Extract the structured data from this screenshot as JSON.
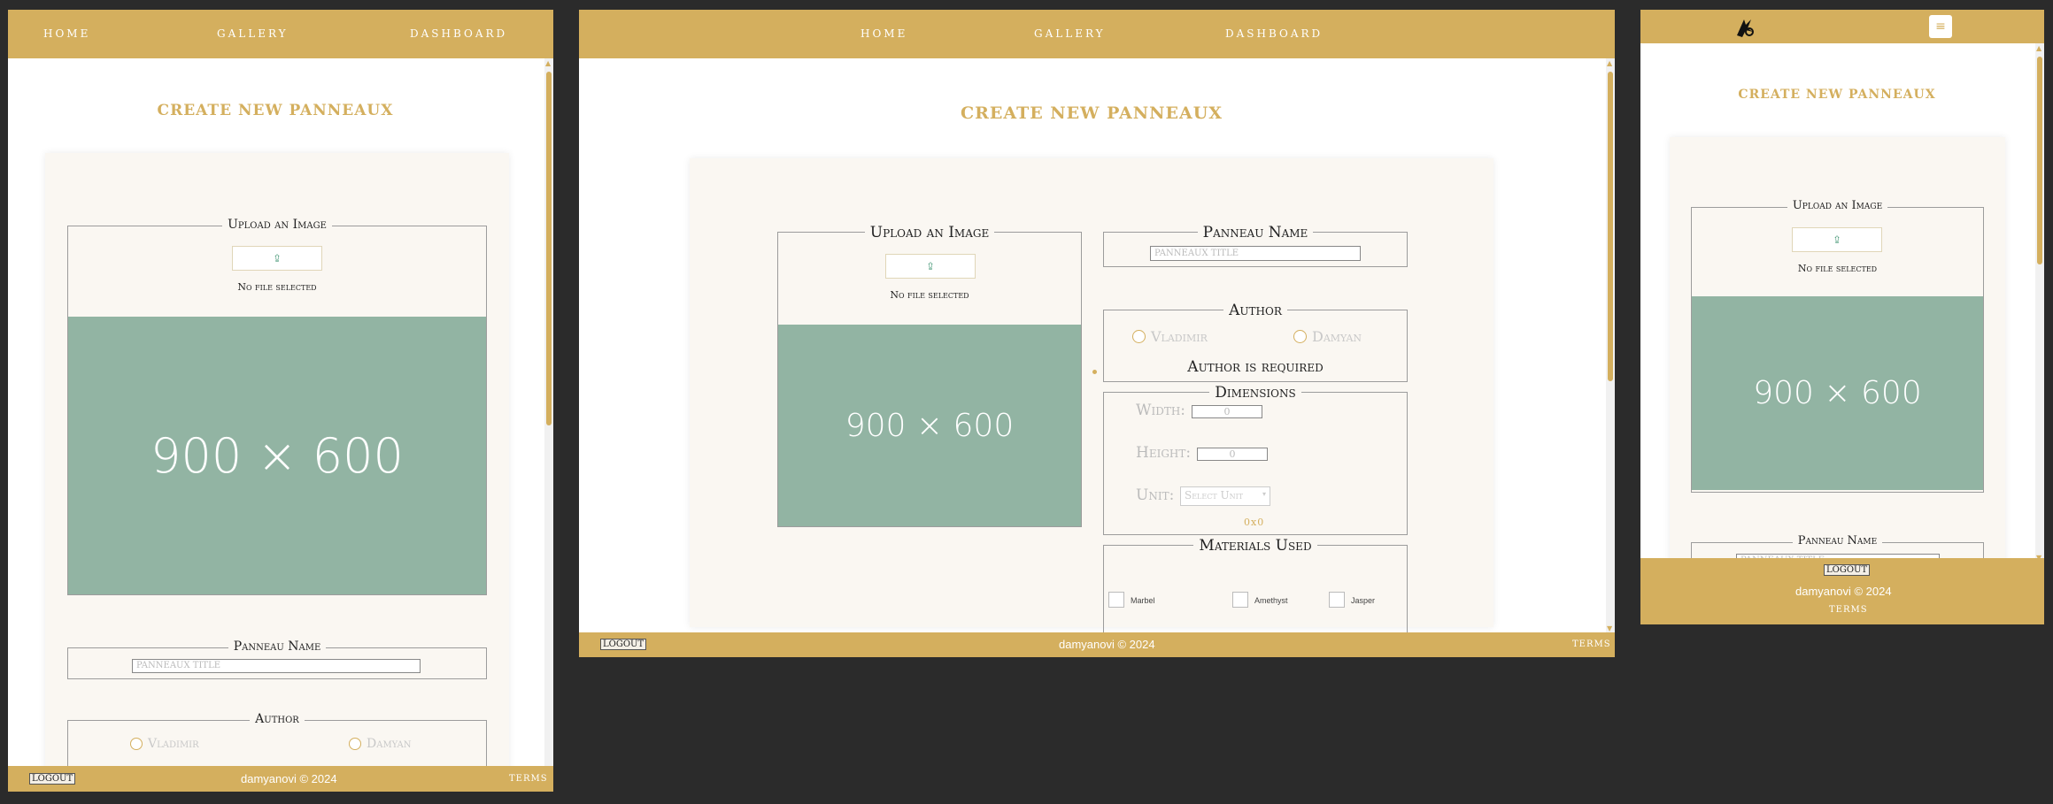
{
  "nav": {
    "home": "Home",
    "gallery": "Gallery",
    "dashboard": "Dashboard"
  },
  "page": {
    "title": "CREATE NEW PANNEAUX"
  },
  "upload": {
    "legend": "Upload an Image",
    "button_icon": "upload-icon",
    "no_file": "No file selected",
    "placeholder_text": "900 × 600"
  },
  "panneau_name": {
    "legend": "Panneau Name",
    "placeholder": "PANNEAUX TITLE"
  },
  "author": {
    "legend": "Author",
    "options": [
      "Vladimir",
      "Damyan"
    ],
    "error": "Author is required"
  },
  "dimensions": {
    "legend": "Dimensions",
    "width_label": "Width:",
    "width_value": "0",
    "height_label": "Height:",
    "height_value": "0",
    "unit_label": "Unit:",
    "unit_placeholder": "Select Unit",
    "preview": "0x0"
  },
  "materials": {
    "legend": "Materials Used",
    "items": [
      "Marbel",
      "Amethyst",
      "Jasper"
    ]
  },
  "footer": {
    "logout": "LOGOUT",
    "copyright": "damyanovi © 2024",
    "terms": "TERMS"
  },
  "colors": {
    "brand_gold": "#d4af5e",
    "placeholder_green": "#92b4a3",
    "card_bg": "#faf7f2",
    "backdrop": "#2b2b2b"
  },
  "icons": {
    "menu": "hamburger-menu-icon",
    "logo": "brand-logo-icon",
    "radio": "radio-circle-icon"
  }
}
